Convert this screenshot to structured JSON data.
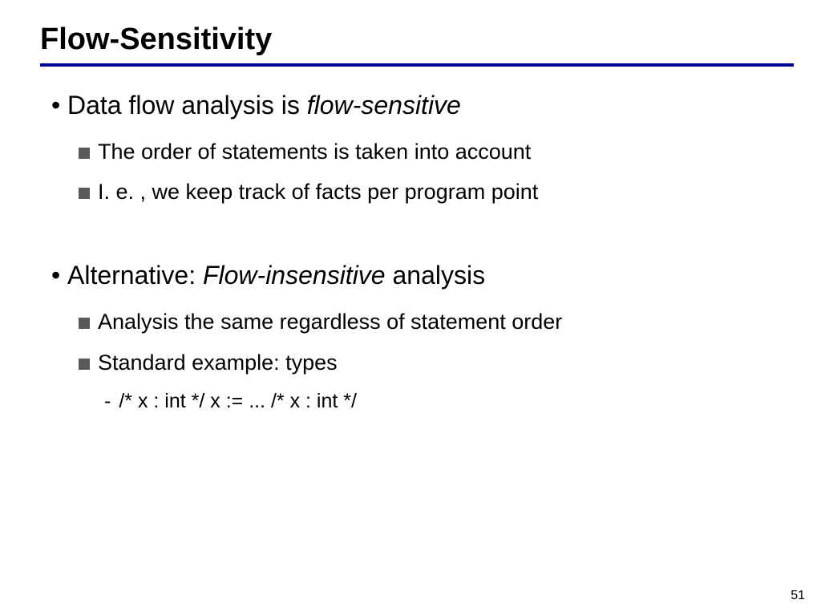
{
  "title": "Flow-Sensitivity",
  "body": {
    "b1": {
      "prefix": "Data flow analysis is ",
      "em": "flow-sensitive",
      "sub1": "The order of statements is taken into account",
      "sub2": "I. e. , we keep track of facts per program point"
    },
    "b2": {
      "prefix": "Alternative:  ",
      "em": "Flow-insensitive",
      "suffix": " analysis",
      "sub1": "Analysis the same regardless of statement order",
      "sub2": "Standard example:  types",
      "sub2a": "/* x : int */ x := ... /* x : int */"
    }
  },
  "page": "51"
}
